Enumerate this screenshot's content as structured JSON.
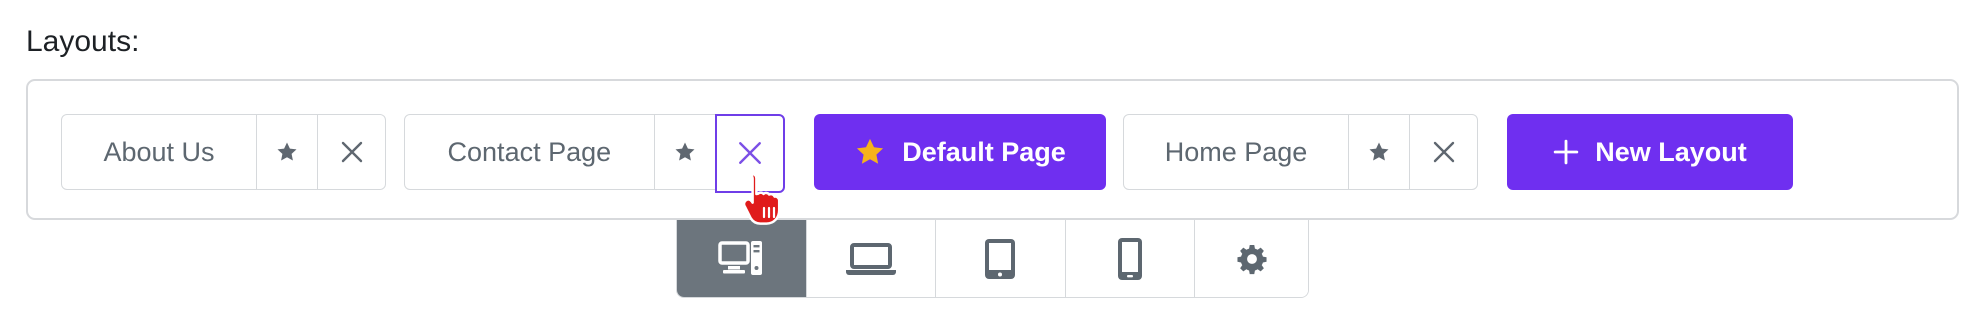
{
  "heading": "Layouts:",
  "layouts": [
    {
      "name": "About Us"
    },
    {
      "name": "Contact Page"
    },
    {
      "name": "Home Page"
    }
  ],
  "default_layout": {
    "label": "Default Page",
    "icon": "star-icon"
  },
  "new_layout": {
    "label": "New Layout",
    "icon": "plus-icon"
  },
  "device_bar": {
    "items": [
      {
        "name": "desktop-icon",
        "selected": true
      },
      {
        "name": "laptop-icon",
        "selected": false
      },
      {
        "name": "tablet-icon",
        "selected": false
      },
      {
        "name": "mobile-icon",
        "selected": false
      },
      {
        "name": "gear-icon",
        "selected": false
      }
    ]
  },
  "colors": {
    "accent": "#6f2ff0",
    "star_gold": "#f5b21c",
    "selected_device_bg": "#6c757d",
    "cursor": "#e01b1b"
  }
}
